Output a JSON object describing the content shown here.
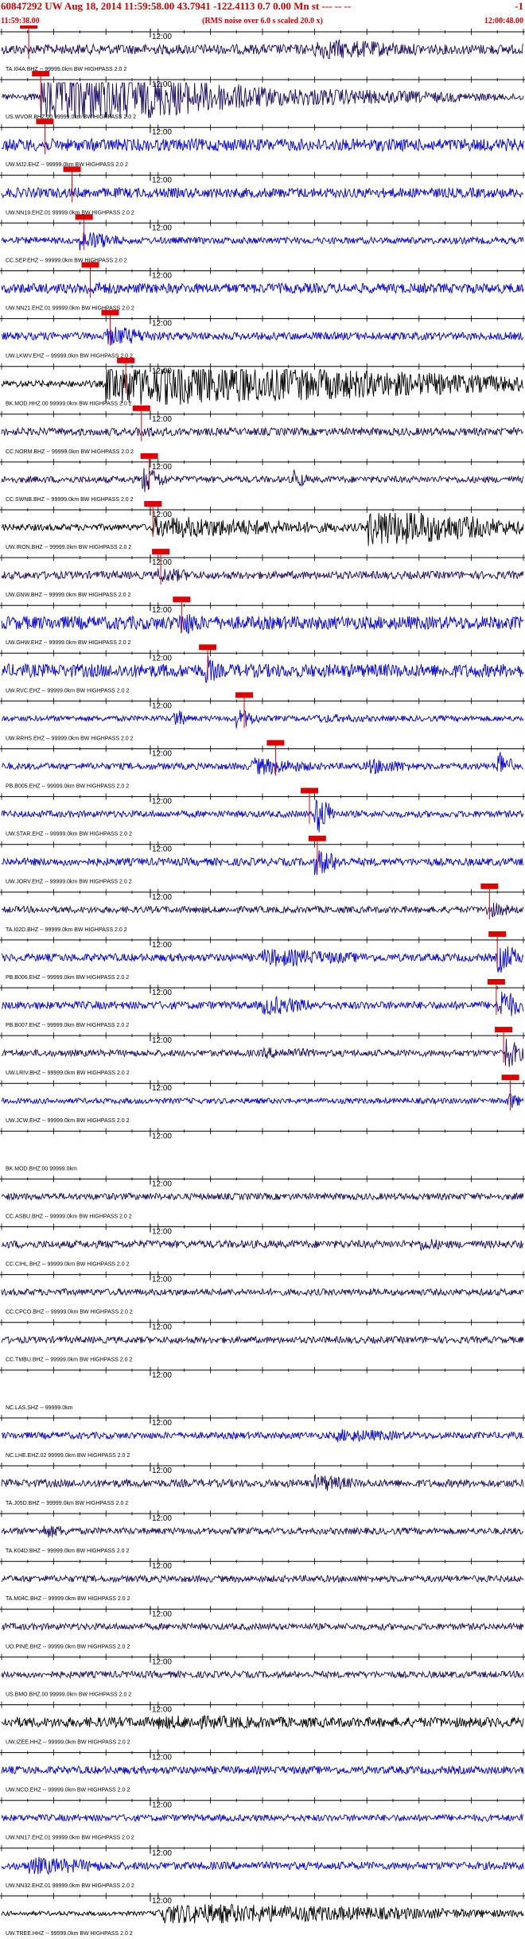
{
  "header": {
    "title": "60847292 UW Aug 18, 2014 11:59:58.00   43.7941 -122.4113  0.7 0.00 Mn st --- -- --",
    "right": "-1",
    "start_time": "11:59:38.00",
    "end_time": "12:00:48.00",
    "note": "(RMS noise over 6.0 s scaled 20.0 x)"
  },
  "chart_data": {
    "type": "line",
    "x_axis": {
      "start": "11:59:38.00",
      "end": "12:00:48.00",
      "center_tick_label": "12:00"
    },
    "colors": {
      "blue": "#0000e6",
      "navy": "#1c0a63",
      "black": "#000000",
      "pick": "#e00000"
    },
    "traces": [
      {
        "label": "TA.I04A.BHZ -- 99999.0km BW  HIGHPASS  2.0  2",
        "color": "navy",
        "amp": 0.45,
        "pick": 0.052,
        "bursts": [
          [
            0.05,
            0.1,
            0.45
          ],
          [
            0.6,
            0.88,
            0.9
          ]
        ]
      },
      {
        "label": "US.WVOR.BHZ.00 99999.0km BW  HIGHPASS  2.0  2",
        "color": "navy",
        "amp": 0.3,
        "pick": 0.075,
        "bursts": [
          [
            0.075,
            0.52,
            2.6
          ],
          [
            0.52,
            1.0,
            0.8
          ]
        ]
      },
      {
        "label": "UW.MJ2.EHZ -- 99999.0km BW  HIGHPASS  2.0  2",
        "color": "blue",
        "amp": 0.55,
        "pick": 0.083,
        "bursts": [
          [
            0.08,
            0.22,
            0.5
          ]
        ]
      },
      {
        "label": "UW.NN19.EHZ.01 99999.0km BW  HIGHPASS  2.0  2",
        "color": "blue",
        "amp": 0.45,
        "pick": 0.135,
        "bursts": [
          [
            0.13,
            0.3,
            0.45
          ]
        ]
      },
      {
        "label": "CC.SEP.EHZ -- 99999.0km BW  HIGHPASS  2.0  2",
        "color": "blue",
        "amp": 0.3,
        "pick": 0.158,
        "bursts": [
          [
            0.15,
            0.24,
            0.9
          ]
        ]
      },
      {
        "label": "UW.NN21.EHZ.01 99999.0km BW  HIGHPASS  2.0  2",
        "color": "blue",
        "amp": 0.45,
        "pick": 0.17,
        "bursts": [
          [
            0.16,
            0.3,
            0.6
          ]
        ]
      },
      {
        "label": "UW.LKWV.EHZ -- 99999.0km BW  HIGHPASS  2.0  2",
        "color": "blue",
        "amp": 0.35,
        "pick": 0.208,
        "bursts": [
          [
            0.2,
            0.32,
            0.9
          ]
        ]
      },
      {
        "label": "BK.MOD.HHZ.00 99999.0km BW  HIGHPASS  2.0  2",
        "color": "black",
        "amp": 0.3,
        "pick": 0.238,
        "bursts": [
          [
            0.2,
            1.0,
            2.0
          ]
        ]
      },
      {
        "label": "CC.NORM.BHZ -- 99999.0km BW  HIGHPASS  2.0  2",
        "color": "navy",
        "amp": 0.35,
        "pick": 0.268,
        "bursts": [
          [
            0.26,
            0.4,
            0.5
          ]
        ]
      },
      {
        "label": "CC.SWNB.BHZ -- 99999.0km BW  HIGHPASS  2.0  2",
        "color": "navy",
        "amp": 0.3,
        "pick": 0.283,
        "bursts": [
          [
            0.27,
            0.32,
            1.2
          ],
          [
            0.56,
            0.59,
            0.9
          ]
        ]
      },
      {
        "label": "UW.IRON.BHZ -- 99999.0km BW  HIGHPASS  2.0  2",
        "color": "black",
        "amp": 0.3,
        "pick": 0.29,
        "bursts": [
          [
            0.29,
            0.7,
            0.95
          ],
          [
            0.7,
            1.0,
            1.7
          ]
        ]
      },
      {
        "label": "UW.GNW.BHZ -- 99999.0km BW  HIGHPASS  2.0  2",
        "color": "navy",
        "amp": 0.35,
        "pick": 0.305,
        "bursts": [
          [
            0.3,
            0.4,
            0.7
          ]
        ]
      },
      {
        "label": "UW.GHW.EHZ -- 99999.0km BW  HIGHPASS  2.0  2",
        "color": "blue",
        "amp": 0.6,
        "pick": 0.345,
        "bursts": [
          [
            0.34,
            0.4,
            1.2
          ]
        ]
      },
      {
        "label": "UW.RVC.EHZ -- 99999.0km BW  HIGHPASS  2.0  2",
        "color": "blue",
        "amp": 0.6,
        "pick": 0.395,
        "bursts": [
          [
            0.39,
            0.42,
            1.4
          ]
        ]
      },
      {
        "label": "UW.RRHS.EHZ -- 99999.0km BW  HIGHPASS  2.0  2",
        "color": "blue",
        "amp": 0.25,
        "pick": 0.465,
        "bursts": [
          [
            0.33,
            0.36,
            0.9
          ],
          [
            0.45,
            0.5,
            0.9
          ],
          [
            0.6,
            0.8,
            0.4
          ]
        ]
      },
      {
        "label": "PB.B005.EHZ -- 99999.0km BW  HIGHPASS  2.0  2",
        "color": "blue",
        "amp": 0.3,
        "pick": 0.525,
        "bursts": [
          [
            0.48,
            0.62,
            0.8
          ],
          [
            0.7,
            0.82,
            0.7
          ],
          [
            0.95,
            0.98,
            1.6
          ]
        ]
      },
      {
        "label": "UW.STAR.EHZ -- 99999.0km BW  HIGHPASS  2.0  2",
        "color": "blue",
        "amp": 0.3,
        "pick": 0.59,
        "bursts": [
          [
            0.6,
            0.64,
            1.8
          ]
        ]
      },
      {
        "label": "UW.JORV.EHZ -- 99999.0km BW  HIGHPASS  2.0  2",
        "color": "blue",
        "amp": 0.35,
        "pick": 0.605,
        "bursts": [
          [
            0.6,
            0.66,
            1.2
          ]
        ]
      },
      {
        "label": "TA.I02D.BHZ -- 99999.0km BW  HIGHPASS  2.0  2",
        "color": "navy",
        "amp": 0.3,
        "pick": 0.935,
        "bursts": [
          [
            0.93,
            1.0,
            0.7
          ]
        ]
      },
      {
        "label": "PB.B006.EHZ -- 99999.0km BW  HIGHPASS  2.0  2",
        "color": "blue",
        "amp": 0.35,
        "pick": 0.95,
        "bursts": [
          [
            0.5,
            0.75,
            0.8
          ],
          [
            0.95,
            1.0,
            1.4
          ]
        ]
      },
      {
        "label": "PB.B007.EHZ -- 99999.0km BW  HIGHPASS  2.0  2",
        "color": "blue",
        "amp": 0.35,
        "pick": 0.948,
        "bursts": [
          [
            0.5,
            0.62,
            0.9
          ],
          [
            0.95,
            1.0,
            1.6
          ]
        ]
      },
      {
        "label": "UW.LRIV.BHZ -- 99999.0km BW  HIGHPASS  2.0  2",
        "color": "navy",
        "amp": 0.3,
        "pick": 0.962,
        "bursts": [
          [
            0.5,
            0.7,
            0.5
          ],
          [
            0.96,
            1.0,
            1.6
          ]
        ]
      },
      {
        "label": "UW.JCW.EHZ -- 99999.0km BW  HIGHPASS  2.0  2",
        "color": "blue",
        "amp": 0.25,
        "pick": 0.975,
        "bursts": [
          [
            0.97,
            1.0,
            0.8
          ]
        ]
      },
      {
        "label": "BK.MOD.BHZ.00 99999.0km",
        "color": "navy",
        "amp": 0.0,
        "pick": null,
        "bursts": []
      },
      {
        "label": "CC.ASBU.BHZ -- 99999.0km BW  HIGHPASS  2.0  2",
        "color": "navy",
        "amp": 0.3,
        "pick": null,
        "bursts": []
      },
      {
        "label": "CC.CIHL.BHZ -- 99999.0km BW  HIGHPASS  2.0  2",
        "color": "navy",
        "amp": 0.35,
        "pick": null,
        "bursts": [
          [
            0.8,
            0.88,
            0.6
          ]
        ]
      },
      {
        "label": "CC.CPCO.BHZ -- 99999.0km BW  HIGHPASS  2.0  2",
        "color": "navy",
        "amp": 0.3,
        "pick": null,
        "bursts": []
      },
      {
        "label": "CC.TMBU.BHZ -- 99999.0km BW  HIGHPASS  2.0  2",
        "color": "navy",
        "amp": 0.3,
        "pick": null,
        "bursts": []
      },
      {
        "label": "NC.LAS.SHZ -- 99999.0km",
        "color": "navy",
        "amp": 0.0,
        "pick": null,
        "bursts": []
      },
      {
        "label": "NC.LHE.EHZ.02 99999.0km BW  HIGHPASS  2.0  2",
        "color": "blue",
        "amp": 0.3,
        "pick": null,
        "bursts": [
          [
            0.64,
            0.84,
            0.6
          ]
        ]
      },
      {
        "label": "TA.J05D.BHZ -- 99999.0km BW  HIGHPASS  2.0  2",
        "color": "navy",
        "amp": 0.35,
        "pick": null,
        "bursts": [
          [
            0.6,
            0.7,
            0.8
          ]
        ]
      },
      {
        "label": "TA.K04D.BHZ -- 99999.0km BW  HIGHPASS  2.0  2",
        "color": "navy",
        "amp": 0.3,
        "pick": null,
        "bursts": [
          [
            0.08,
            0.16,
            0.6
          ]
        ]
      },
      {
        "label": "TA.M04C.BHZ -- 99999.0km BW  HIGHPASS  2.0  2",
        "color": "navy",
        "amp": 0.3,
        "pick": null,
        "bursts": []
      },
      {
        "label": "UO.PINE.BHZ -- 99999.0km BW  HIGHPASS  2.0  2",
        "color": "navy",
        "amp": 0.3,
        "pick": null,
        "bursts": []
      },
      {
        "label": "US.BMO.BHZ.00 99999.0km BW  HIGHPASS  2.0  2",
        "color": "navy",
        "amp": 0.3,
        "pick": null,
        "bursts": []
      },
      {
        "label": "UW.IZEE.HHZ -- 99999.0km BW  HIGHPASS  2.0  2",
        "color": "black",
        "amp": 0.45,
        "pick": null,
        "bursts": [
          [
            0.3,
            0.9,
            0.6
          ]
        ]
      },
      {
        "label": "UW.NCO.EHZ -- 99999.0km BW  HIGHPASS  2.0  2",
        "color": "blue",
        "amp": 0.35,
        "pick": null,
        "bursts": []
      },
      {
        "label": "UW.NN17.EHZ.01 99999.0km BW  HIGHPASS  2.0  2",
        "color": "blue",
        "amp": 0.3,
        "pick": null,
        "bursts": []
      },
      {
        "label": "UW.NN32.EHZ.01 99999.0km BW  HIGHPASS  2.0  2",
        "color": "blue",
        "amp": 0.35,
        "pick": null,
        "bursts": [
          [
            0.05,
            0.25,
            0.8
          ]
        ]
      },
      {
        "label": "UW.TREE.HHZ -- 99999.0km BW  HIGHPASS  2.0  2",
        "color": "black",
        "amp": 0.2,
        "pick": null,
        "bursts": [
          [
            0.3,
            1.0,
            0.9
          ]
        ]
      }
    ]
  }
}
